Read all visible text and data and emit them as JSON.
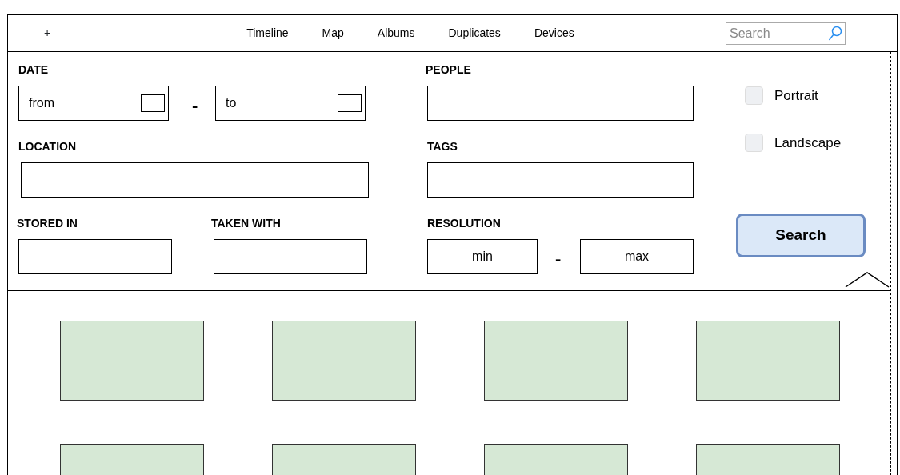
{
  "nav": {
    "add_label": "+",
    "links": [
      {
        "label": "Timeline"
      },
      {
        "label": "Map"
      },
      {
        "label": "Albums"
      },
      {
        "label": "Duplicates"
      },
      {
        "label": "Devices"
      }
    ],
    "search": {
      "placeholder": "Search"
    }
  },
  "filters": {
    "date": {
      "label": "DATE",
      "from": {
        "placeholder": "from"
      },
      "separator": "-",
      "to": {
        "placeholder": "to"
      }
    },
    "location": {
      "label": "LOCATION"
    },
    "stored_in": {
      "label": "STORED IN"
    },
    "taken_with": {
      "label": "TAKEN WITH"
    },
    "people": {
      "label": "PEOPLE"
    },
    "tags": {
      "label": "TAGS"
    },
    "resolution": {
      "label": "RESOLUTION",
      "min": {
        "placeholder": "min"
      },
      "separator": "-",
      "max": {
        "placeholder": "max"
      }
    },
    "orientations": [
      {
        "label": "Portrait",
        "checked": false
      },
      {
        "label": "Landscape",
        "checked": false
      }
    ],
    "search_button": "Search",
    "expanded": true
  },
  "gallery": [
    {
      "kind": "image"
    },
    {
      "kind": "image"
    },
    {
      "kind": "image"
    },
    {
      "kind": "image"
    },
    {
      "kind": "image"
    },
    {
      "kind": "image"
    },
    {
      "kind": "image"
    },
    {
      "kind": "image"
    }
  ]
}
